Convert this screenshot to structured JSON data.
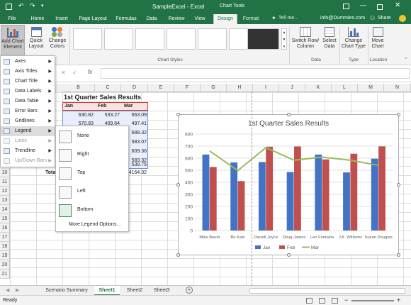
{
  "window": {
    "title": "SampleExcel - Excel",
    "context_title": "Chart Tools",
    "tell_me": "Tell me...",
    "account": "info@Dummies.com",
    "share": "Share"
  },
  "tabs": [
    "File",
    "Home",
    "Insert",
    "Page Layout",
    "Formulas",
    "Data",
    "Review",
    "View",
    "Design",
    "Format"
  ],
  "ribbon": {
    "add_chart_element": "Add Chart Element",
    "quick_layout": "Quick Layout",
    "change_colors": "Change Colors",
    "switch_row_column": "Switch Row/ Column",
    "select_data": "Select Data",
    "change_chart_type": "Change Chart Type",
    "move_chart": "Move Chart",
    "groups": {
      "chart_styles": "Chart Styles",
      "data": "Data",
      "type": "Type",
      "location": "Location"
    }
  },
  "formula_bar": {
    "value": ""
  },
  "columns": [
    "B",
    "C",
    "D",
    "E",
    "F",
    "G",
    "H",
    "I",
    "J",
    "K",
    "L",
    "M",
    "N"
  ],
  "rows": [
    "10",
    "11",
    "12",
    "13",
    "14",
    "15",
    "16",
    "17",
    "18",
    "19",
    "20",
    "21",
    "22",
    "23",
    "24",
    "25",
    "26",
    "27"
  ],
  "sheet": {
    "title": "1st Quarter Sales Results",
    "headers": [
      "Jan",
      "Feb",
      "Mar"
    ],
    "data": [
      [
        "630.82",
        "533.27",
        "663.09"
      ],
      [
        "570.83",
        "409.64",
        "497.41"
      ],
      [
        "",
        "",
        "688.32"
      ],
      [
        "",
        "",
        "583.07"
      ],
      [
        "",
        "",
        "609.36"
      ],
      [
        "",
        "",
        "583.32"
      ],
      [
        "",
        "",
        "539.75"
      ]
    ],
    "total_label": "Tota",
    "total_value": "4164.32"
  },
  "menu": {
    "items": [
      {
        "label": "Axes",
        "disabled": false,
        "arrow": true
      },
      {
        "label": "Axis Titles",
        "disabled": false,
        "arrow": true
      },
      {
        "label": "Chart Title",
        "disabled": false,
        "arrow": true
      },
      {
        "label": "Data Labels",
        "disabled": false,
        "arrow": true
      },
      {
        "label": "Data Table",
        "disabled": false,
        "arrow": true
      },
      {
        "label": "Error Bars",
        "disabled": false,
        "arrow": true
      },
      {
        "label": "Gridlines",
        "disabled": false,
        "arrow": true
      },
      {
        "label": "Legend",
        "disabled": false,
        "arrow": true
      },
      {
        "label": "Lines",
        "disabled": true,
        "arrow": true
      },
      {
        "label": "Trendline",
        "disabled": false,
        "arrow": true
      },
      {
        "label": "Up/Down Bars",
        "disabled": true,
        "arrow": true
      }
    ],
    "legend_submenu": [
      "None",
      "Right",
      "Top",
      "Left",
      "Bottom"
    ],
    "more_options": "More Legend Options..."
  },
  "sheet_tabs": [
    "Scenario Summary",
    "Sheet1",
    "Sheet2",
    "Sheet3"
  ],
  "status": "Ready",
  "colors": {
    "jan": "#4472c4",
    "feb": "#c0504d",
    "mar": "#9bbb59",
    "excel_green": "#217346"
  },
  "chart_data": {
    "type": "bar",
    "title": "1st Quarter Sales Results",
    "categories": [
      "Mike Baum",
      "Bo Katz",
      "Darrell Joyce",
      "Doug James",
      "Leo Fontaine",
      "J.K. Williams",
      "Susan Douglas"
    ],
    "series": [
      {
        "name": "Jan",
        "type": "bar",
        "values": [
          630,
          565,
          568,
          485,
          630,
          482,
          596
        ]
      },
      {
        "name": "Feb",
        "type": "bar",
        "values": [
          527,
          410,
          695,
          697,
          590,
          637,
          698
        ]
      },
      {
        "name": "Mar",
        "type": "line",
        "values": [
          660,
          497,
          688,
          583,
          609,
          583,
          540
        ]
      }
    ],
    "ylim": [
      0,
      800
    ],
    "yticks": [
      "0",
      "100",
      "200",
      "300",
      "400",
      "500",
      "600",
      "700",
      "800"
    ],
    "legend": "bottom",
    "grid": true
  }
}
